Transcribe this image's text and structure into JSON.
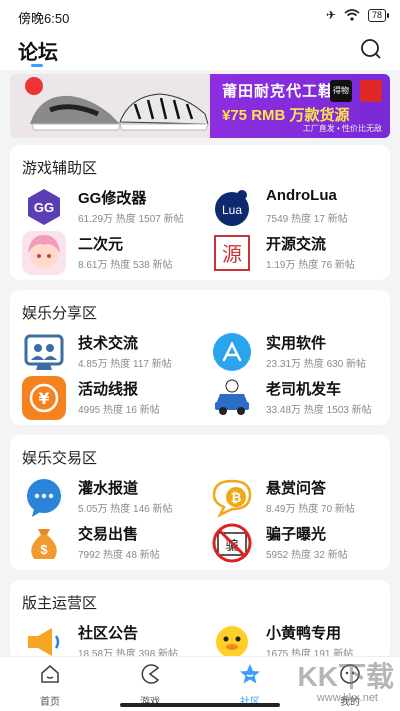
{
  "status": {
    "time": "傍晚6:50",
    "battery": "78"
  },
  "header": {
    "title": "论坛"
  },
  "banner": {
    "headline": "莆田耐克代工鞋厂",
    "price_line": "¥75 RMB 万款货源",
    "footer": "工厂直发 • 性价比无敌",
    "logo_text": "得物"
  },
  "sections": [
    {
      "title": "游戏辅助区",
      "items": [
        {
          "name": "GG修改器",
          "stats": "61.29万 热度  1507 新帖",
          "icon": "gg-icon"
        },
        {
          "name": "AndroLua",
          "stats": "7549 热度  17 新帖",
          "icon": "lua-icon"
        },
        {
          "name": "二次元",
          "stats": "8.61万 热度  538 新帖",
          "icon": "anime-icon"
        },
        {
          "name": "开源交流",
          "stats": "1.19万 热度  76 新帖",
          "icon": "yuan-icon"
        }
      ]
    },
    {
      "title": "娱乐分享区",
      "items": [
        {
          "name": "技术交流",
          "stats": "4.85万 热度  117 新帖",
          "icon": "tech-icon"
        },
        {
          "name": "实用软件",
          "stats": "23.31万 热度  630 新帖",
          "icon": "appstore-icon"
        },
        {
          "name": "活动线报",
          "stats": "4995 热度  16 新帖",
          "icon": "yen-icon"
        },
        {
          "name": "老司机发车",
          "stats": "33.48万 热度  1503 新帖",
          "icon": "car-icon"
        }
      ]
    },
    {
      "title": "娱乐交易区",
      "items": [
        {
          "name": "灌水报道",
          "stats": "5.05万 热度  146 新帖",
          "icon": "chat-icon"
        },
        {
          "name": "悬赏问答",
          "stats": "8.49万 热度  70 新帖",
          "icon": "bitcoin-icon"
        },
        {
          "name": "交易出售",
          "stats": "7992 热度  48 新帖",
          "icon": "moneybag-icon"
        },
        {
          "name": "骗子曝光",
          "stats": "5952 热度  32 新帖",
          "icon": "scam-icon"
        }
      ]
    },
    {
      "title": "版主运营区",
      "items": [
        {
          "name": "社区公告",
          "stats": "18.58万 热度  398 新帖",
          "icon": "megaphone-icon"
        },
        {
          "name": "小黄鸭专用",
          "stats": "1675 热度  191 新帖",
          "icon": "duck-icon"
        }
      ]
    }
  ],
  "tabs": [
    {
      "label": "首页"
    },
    {
      "label": "游戏"
    },
    {
      "label": "社区"
    },
    {
      "label": "我的"
    }
  ],
  "watermark": {
    "text": "KK下载",
    "url": "www.kkx.net"
  },
  "colors": {
    "accent": "#3aa0ff"
  }
}
